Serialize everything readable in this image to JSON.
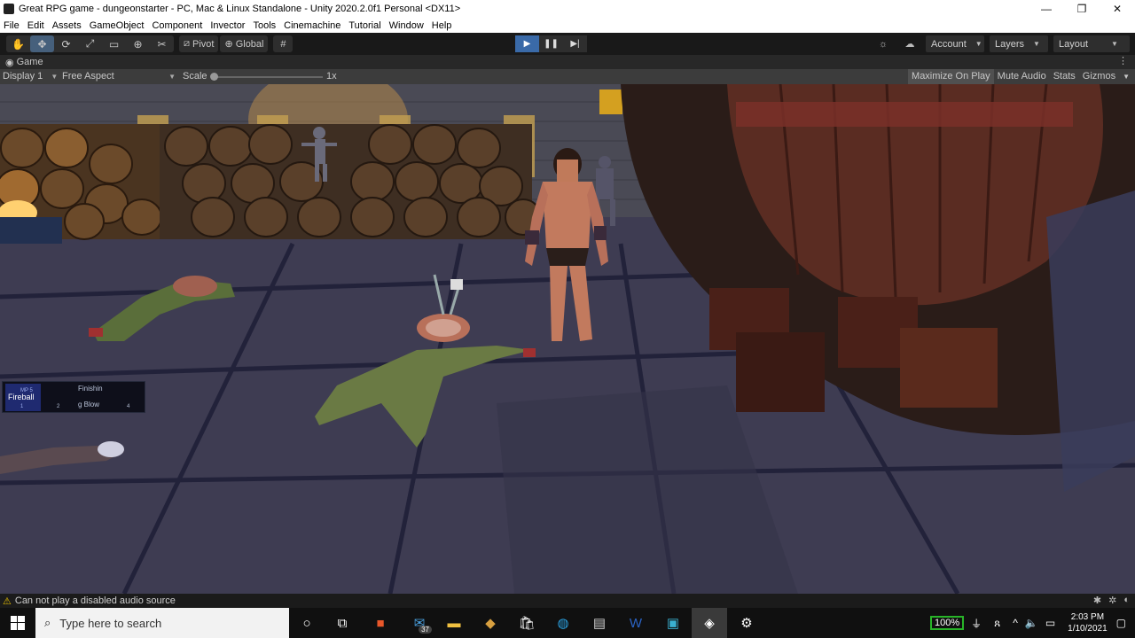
{
  "window": {
    "title": "Great RPG game - dungeonstarter - PC, Mac & Linux Standalone - Unity 2020.2.0f1 Personal <DX11>",
    "controls": [
      "—",
      "❐",
      "✕"
    ]
  },
  "menu": [
    "File",
    "Edit",
    "Assets",
    "GameObject",
    "Component",
    "Invector",
    "Tools",
    "Cinemachine",
    "Tutorial",
    "Window",
    "Help"
  ],
  "toolbar": {
    "pivot_label": "Pivot",
    "global_label": "Global",
    "account_label": "Account",
    "layers_label": "Layers",
    "layout_label": "Layout",
    "play_state": "playing"
  },
  "game_tab": {
    "label": "Game",
    "display": "Display 1",
    "aspect": "Free Aspect",
    "scale_label": "Scale",
    "scale_value": "1x",
    "maximize_on_play": "Maximize On Play",
    "mute_audio": "Mute Audio",
    "stats": "Stats",
    "gizmos": "Gizmos"
  },
  "hud": {
    "skill1_name": "Fireball",
    "skill1_cost": "MP 5",
    "slot1_number": "1",
    "slot2_number": "2",
    "skill2_name_line1": "Finishin",
    "skill2_name_line2": "g Blow",
    "slot4_number": "4"
  },
  "status": {
    "message": "Can not play a disabled audio source"
  },
  "taskbar": {
    "search_placeholder": "Type here to search",
    "mail_badge": "37",
    "battery": "100%",
    "time": "2:03 PM",
    "date": "1/10/2021"
  },
  "colors": {
    "unity_toolbar": "#191919",
    "play_active": "#3a6aa8",
    "dungeon_floor": "#3b3a4e",
    "warning": "#e8c000"
  }
}
